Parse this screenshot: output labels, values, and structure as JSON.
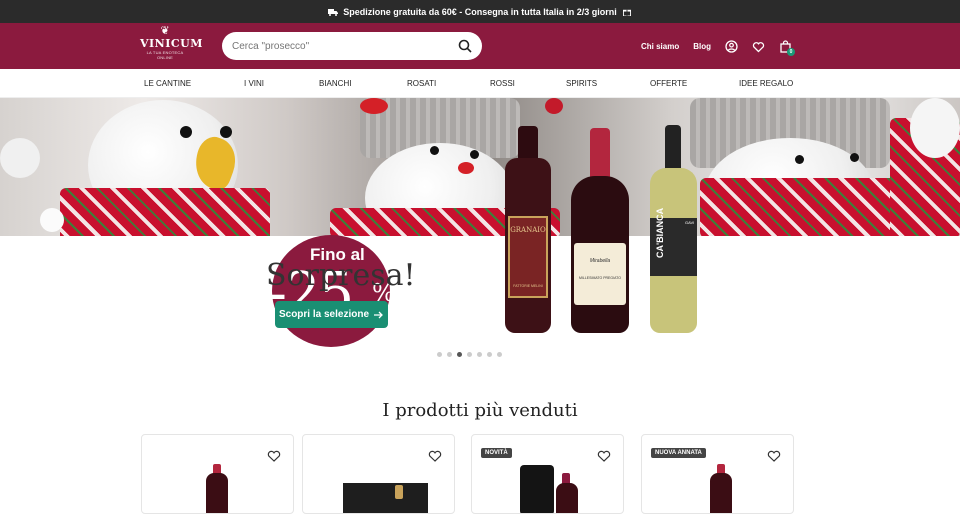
{
  "topbar": {
    "text": "Spedizione gratuita da 60€ - Consegna in tutta Italia in 2/3 giorni"
  },
  "header": {
    "logo": {
      "name": "VINICUM",
      "tagline": "LA TUA ENOTECA ONLINE"
    },
    "search": {
      "placeholder": "Cerca \"prosecco\""
    },
    "nav": {
      "chi_siamo": "Chi siamo",
      "blog": "Blog"
    },
    "cart_count": "0"
  },
  "categories": [
    "LE CANTINE",
    "I VINI",
    "BIANCHI",
    "ROSATI",
    "ROSSI",
    "SPIRITS",
    "OFFERTE",
    "IDEE REGALO"
  ],
  "hero": {
    "badge_prefix": "Fino al",
    "badge_value": "-25",
    "badge_percent": "%",
    "headline": "Sorpresa!",
    "cta": "Scopri la selezione",
    "bottles": [
      {
        "label_1": "GRANAIO",
        "label_2": "FATTORIE MELINI",
        "color": "#3d1116",
        "label_color": "#7a2424"
      },
      {
        "label_1": "Mirabella",
        "label_2": "MILLESIMATO PREGIATO",
        "color": "#2b0c10",
        "label_color": "#f4ecd8"
      },
      {
        "label_1": "CA'BIANCA",
        "label_2": "GAVI",
        "color": "#c8c47a",
        "label_color": "#2a2a2a"
      }
    ],
    "slides": 7,
    "active_slide": 3
  },
  "bestsellers": {
    "title": "I prodotti più venduti",
    "cards": [
      {
        "tag": ""
      },
      {
        "tag": ""
      },
      {
        "tag": "NOVITÀ"
      },
      {
        "tag": "NUOVA ANNATA"
      }
    ]
  },
  "colors": {
    "brand": "#8b1a3e",
    "cta": "#1a8f73",
    "topbar": "#2b2b2b"
  }
}
